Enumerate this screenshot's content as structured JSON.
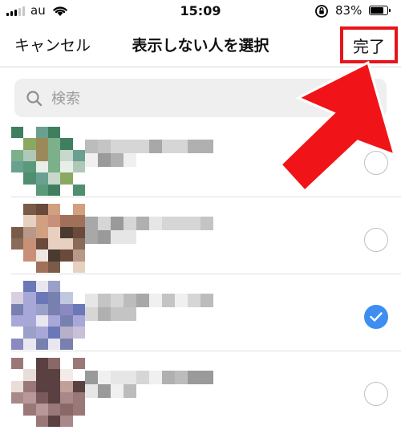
{
  "status_bar": {
    "carrier": "au",
    "time": "15:09",
    "battery_percent_label": "83%",
    "battery_level": 0.83
  },
  "nav": {
    "cancel_label": "キャンセル",
    "title": "表示しない人を選択",
    "done_label": "完了"
  },
  "search": {
    "placeholder": "検索",
    "value": ""
  },
  "contacts": [
    {
      "avatar": "pixelated-avatar-green",
      "name": "",
      "selected": false
    },
    {
      "avatar": "pixelated-avatar-brown",
      "name": "",
      "selected": false
    },
    {
      "avatar": "pixelated-avatar-purple",
      "name": "",
      "selected": true
    },
    {
      "avatar": "pixelated-avatar-beige",
      "name": "",
      "selected": false
    }
  ],
  "colors": {
    "accent_blue": "#3d8ef0",
    "annotation_red": "#e8141c"
  },
  "icons": {
    "search": "search-icon",
    "check": "checkmark-icon",
    "wifi": "wifi-icon",
    "rotation_lock": "rotation-lock-icon",
    "battery": "battery-icon",
    "signal": "signal-icon",
    "annotation_arrow": "red-arrow-annotation"
  }
}
